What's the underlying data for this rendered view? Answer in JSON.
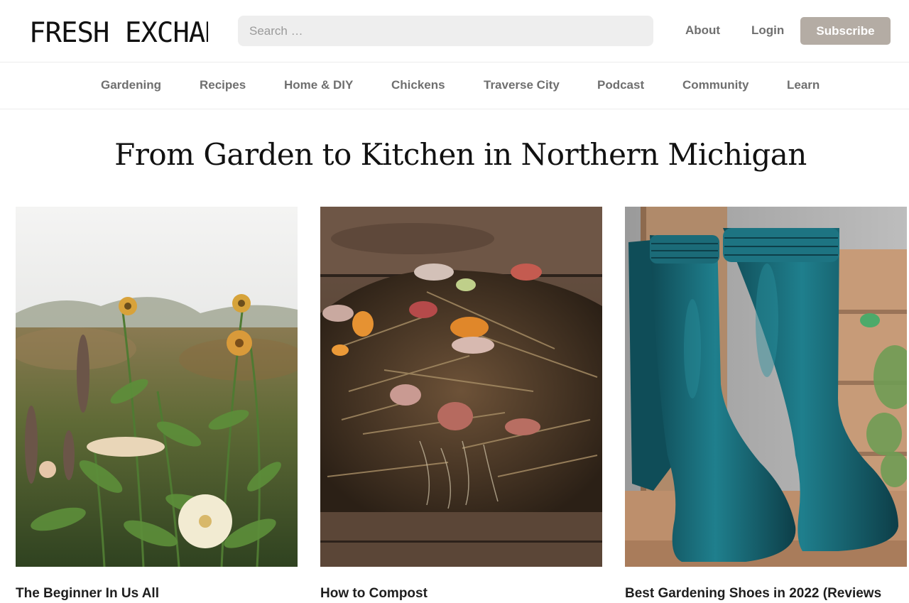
{
  "header": {
    "logo_text": "FRESH EXCHANGE",
    "search_placeholder": "Search …",
    "about_label": "About",
    "login_label": "Login",
    "subscribe_label": "Subscribe"
  },
  "nav": {
    "items": [
      {
        "label": "Gardening"
      },
      {
        "label": "Recipes"
      },
      {
        "label": "Home & DIY"
      },
      {
        "label": "Chickens"
      },
      {
        "label": "Traverse City"
      },
      {
        "label": "Podcast"
      },
      {
        "label": "Community"
      },
      {
        "label": "Learn"
      }
    ]
  },
  "main": {
    "title": "From Garden to Kitchen in Northern Michigan",
    "cards": [
      {
        "title": "The Beginner In Us All",
        "image": "zinnia-garden-photo"
      },
      {
        "title": "How to Compost",
        "image": "compost-pile-photo"
      },
      {
        "title": "Best Gardening Shoes in 2022 (Reviews",
        "image": "teal-rain-boots-photo"
      }
    ]
  },
  "colors": {
    "subscribe_bg": "#b4aca4",
    "nav_text": "#6f6f6f",
    "search_bg": "#eeeeee"
  }
}
